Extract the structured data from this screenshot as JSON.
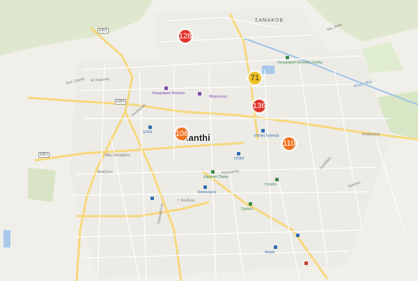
{
  "map": {
    "place_label": "Xanthi",
    "district_label": "ΣΑΜΑΚΟΒ",
    "river_label": "Κοσυνθος",
    "road_shields": [
      "E853",
      "E853",
      "E853"
    ],
    "clusters": [
      {
        "count": "128",
        "color": "#e2332b"
      },
      {
        "count": "71",
        "color": "#efc221"
      },
      {
        "count": "136",
        "color": "#e2332b"
      },
      {
        "count": "106",
        "color": "#f1731e"
      },
      {
        "count": "110",
        "color": "#f1731e"
      }
    ],
    "pois": {
      "museum": "Λαογραφικό Μουσείο",
      "church": "Μητρόπολη",
      "folk_museum": "Λαογραφικό Μουσείο Ξάνθης",
      "post_office": "ΕΛΤΑ",
      "bank1": "Εθνική Τράπεζα",
      "bank2": "ΟΠΑΠ",
      "stadium": "Γήπεδο",
      "park": "Δημοτικό Πάρκο",
      "hospital": "Νοσοκομείο",
      "school": "Σχολείο",
      "market": "Αγορά"
    },
    "streets": [
      "Βασ. Σοφίας",
      "Μ. Καραολή",
      "Κονδυλάκη",
      "28ης Οκτωβρίου",
      "Βενιζέλου",
      "Παπαφλέσσα",
      "Γ. Κονδύλη",
      "Καραμανλή",
      "Τσαλδάρη",
      "Ορφέως",
      "Μιχ. Βόδα",
      "Αναξαγόρα"
    ]
  }
}
